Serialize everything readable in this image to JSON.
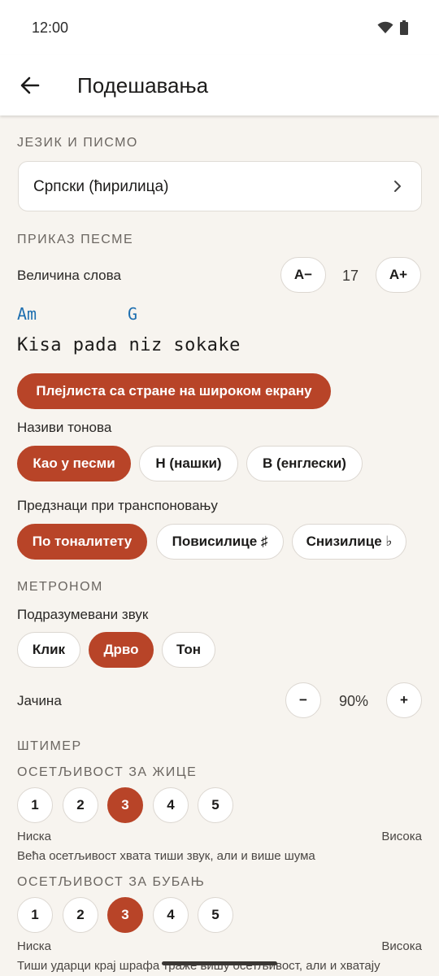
{
  "status_bar": {
    "time": "12:00"
  },
  "app_bar": {
    "title": "Подешавања"
  },
  "language": {
    "header": "ЈЕЗИК И ПИСМО",
    "selected": "Српски (ћирилица)"
  },
  "song_display": {
    "header": "ПРИКАЗ ПЕСМЕ",
    "font_size_label": "Величина слова",
    "font_decrease": "A−",
    "font_size_value": "17",
    "font_increase": "A+",
    "preview_chord_1": "Am",
    "preview_chord_2": "G",
    "preview_lyric": "Kisa pada niz sokake",
    "sidebar_playlist_toggle": "Плејлиста са стране на широком екрану",
    "note_names_label": "Називи тонова",
    "note_names_options": [
      "Као у песми",
      "Н (нашки)",
      "В (енглески)"
    ],
    "accidentals_label": "Предзнаци при транспоновању",
    "accidentals_options": [
      "По тоналитету",
      "Повисилице ♯",
      "Снизилице ♭"
    ]
  },
  "metronome": {
    "header": "МЕТРОНОМ",
    "default_sound_label": "Подразумевани звук",
    "sound_options": [
      "Клик",
      "Дрво",
      "Тон"
    ],
    "volume_label": "Јачина",
    "volume_decrease": "−",
    "volume_value": "90%",
    "volume_increase": "+"
  },
  "tuner": {
    "header": "ШТИМЕР",
    "strings_sensitivity_label": "ОСЕТЉИВОСТ ЗА ЖИЦЕ",
    "strings_levels": [
      "1",
      "2",
      "3",
      "4",
      "5"
    ],
    "strings_selected": 3,
    "low_label": "Ниска",
    "high_label": "Висока",
    "strings_hint": "Већа осетљивост хвата тиши звук, али и више шума",
    "drum_sensitivity_label": "ОСЕТЉИВОСТ ЗА БУБАЊ",
    "drum_levels": [
      "1",
      "2",
      "3",
      "4",
      "5"
    ],
    "drum_selected": 3,
    "drum_low_label": "Ниска",
    "drum_high_label": "Висока",
    "drum_hint": "Тиши ударци крај шрафа траже вишу осетљивост, али и хватају"
  },
  "colors": {
    "accent": "#b84428",
    "chord": "#1e6fb0",
    "background": "#f7f4ef"
  }
}
